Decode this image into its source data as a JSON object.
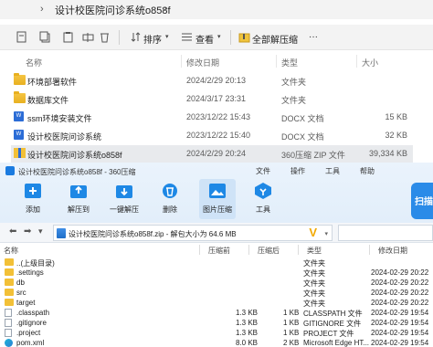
{
  "explorer": {
    "title": "设计校医院问诊系统o858f",
    "toolbar": {
      "sort_label": "排序",
      "view_label": "查看",
      "extract_all_label": "全部解压缩",
      "more_label": "···"
    },
    "columns": {
      "name": "名称",
      "date": "修改日期",
      "type": "类型",
      "size": "大小"
    },
    "rows": [
      {
        "icon": "folder-icon",
        "name": "环境部署软件",
        "date": "2024/2/29 20:13",
        "type": "文件夹",
        "size": ""
      },
      {
        "icon": "folder-icon",
        "name": "数据库文件",
        "date": "2024/3/17 23:31",
        "type": "文件夹",
        "size": ""
      },
      {
        "icon": "docx-icon",
        "name": "ssm环境安装文件",
        "date": "2023/12/22 15:43",
        "type": "DOCX 文档",
        "size": "15 KB"
      },
      {
        "icon": "docx-icon",
        "name": "设计校医院问诊系统",
        "date": "2023/12/22 15:40",
        "type": "DOCX 文档",
        "size": "32 KB"
      },
      {
        "icon": "zip-icon",
        "name": "设计校医院问诊系统o858f",
        "date": "2024/2/29 20:24",
        "type": "360压缩 ZIP 文件",
        "size": "39,334 KB"
      }
    ]
  },
  "zip": {
    "title": "设计校医院问诊系统o858f - 360压缩",
    "menu": [
      "文件",
      "操作",
      "工具",
      "帮助"
    ],
    "buttons": [
      {
        "label": "添加"
      },
      {
        "label": "解压到"
      },
      {
        "label": "一键解压"
      },
      {
        "label": "删除"
      },
      {
        "label": "图片压缩"
      },
      {
        "label": "工具"
      }
    ],
    "scan_label": "扫描",
    "path": "设计校医院问诊系统o858f.zip - 解包大小为 64.6 MB",
    "columns": {
      "name": "名称",
      "compressed": "压缩前",
      "after": "压缩后",
      "type": "类型",
      "date": "修改日期"
    },
    "rows": [
      {
        "icon": "folder-up-icon",
        "name": "..(上级目录)",
        "compressed": "",
        "after": "",
        "type": "文件夹",
        "date": ""
      },
      {
        "icon": "folder-icon",
        "name": ".settings",
        "compressed": "",
        "after": "",
        "type": "文件夹",
        "date": "2024-02-29 20:22"
      },
      {
        "icon": "folder-icon",
        "name": "db",
        "compressed": "",
        "after": "",
        "type": "文件夹",
        "date": "2024-02-29 20:22"
      },
      {
        "icon": "folder-icon",
        "name": "src",
        "compressed": "",
        "after": "",
        "type": "文件夹",
        "date": "2024-02-29 20:22"
      },
      {
        "icon": "folder-icon",
        "name": "target",
        "compressed": "",
        "after": "",
        "type": "文件夹",
        "date": "2024-02-29 20:22"
      },
      {
        "icon": "file-icon",
        "name": ".classpath",
        "compressed": "1.3 KB",
        "after": "1 KB",
        "type": "CLASSPATH 文件",
        "date": "2024-02-29 19:54"
      },
      {
        "icon": "file-icon",
        "name": ".gitignore",
        "compressed": "1.3 KB",
        "after": "1 KB",
        "type": "GITIGNORE 文件",
        "date": "2024-02-29 19:54"
      },
      {
        "icon": "file-icon",
        "name": ".project",
        "compressed": "1.3 KB",
        "after": "1 KB",
        "type": "PROJECT 文件",
        "date": "2024-02-29 19:54"
      },
      {
        "icon": "edge-icon",
        "name": "pom.xml",
        "compressed": "8.0 KB",
        "after": "2 KB",
        "type": "Microsoft Edge HT...",
        "date": "2024-02-29 19:54"
      }
    ]
  }
}
